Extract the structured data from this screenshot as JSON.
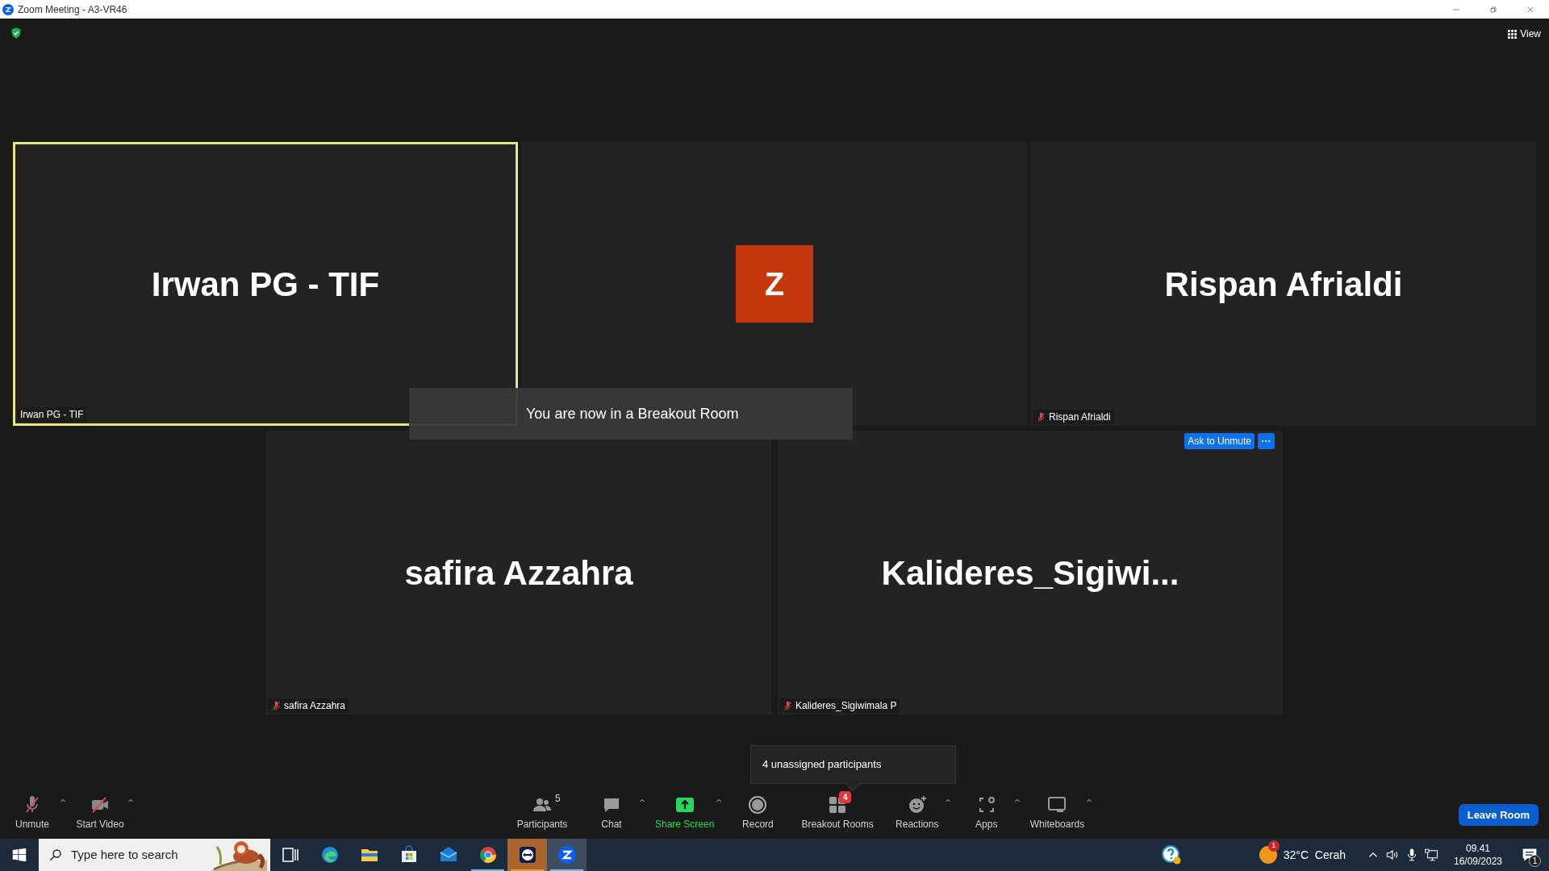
{
  "window": {
    "title": "Zoom Meeting - A3-VR46"
  },
  "top_bar": {
    "view_label": "View"
  },
  "tile_rows": [
    [
      {
        "kind": "name",
        "display": "Irwan PG - TIF",
        "label": "Irwan PG - TIF",
        "muted": false,
        "speaking": true
      },
      {
        "kind": "avatar",
        "display": "Z",
        "muted": false,
        "speaking": false
      },
      {
        "kind": "name",
        "display": "Rispan Afrialdi",
        "label": "Rispan Afrialdi",
        "muted": true,
        "speaking": false
      }
    ],
    [
      {
        "kind": "name",
        "display": "safira Azzahra",
        "label": "safira Azzahra",
        "muted": true,
        "speaking": false
      },
      {
        "kind": "name",
        "display": "Kalideres_Sigiwi...",
        "label": "Kalideres_Sigiwimala P",
        "muted": true,
        "speaking": false,
        "actions": {
          "ask_label": "Ask to Unmute",
          "more_label": "···"
        }
      }
    ]
  ],
  "toast": {
    "text": "You are now in a Breakout Room"
  },
  "tooltip": {
    "text": "4 unassigned participants"
  },
  "toolbar": {
    "left": [
      {
        "kind": "audio",
        "label": "Unmute",
        "off": true,
        "caret": true
      },
      {
        "kind": "video",
        "label": "Start Video",
        "off": true,
        "caret": true
      }
    ],
    "center": [
      {
        "kind": "participants",
        "label": "Participants",
        "count": "5",
        "caret": false
      },
      {
        "kind": "chat",
        "label": "Chat",
        "caret": true
      },
      {
        "kind": "share",
        "label": "Share Screen",
        "caret": true
      },
      {
        "kind": "record",
        "label": "Record",
        "caret": false
      },
      {
        "kind": "breakout",
        "label": "Breakout Rooms",
        "badge": "4",
        "caret": false
      },
      {
        "kind": "reactions",
        "label": "Reactions",
        "caret": true
      },
      {
        "kind": "apps",
        "label": "Apps",
        "caret": true
      },
      {
        "kind": "whiteboards",
        "label": "Whiteboards",
        "caret": true
      }
    ],
    "leave_label": "Leave Room"
  },
  "taskbar": {
    "search": {
      "placeholder": "Type here to search"
    },
    "apps": [
      {
        "kind": "taskview",
        "running": false,
        "selected": false,
        "flashing": false
      },
      {
        "kind": "edge",
        "running": false,
        "selected": false,
        "flashing": false
      },
      {
        "kind": "files",
        "running": false,
        "selected": false,
        "flashing": false
      },
      {
        "kind": "store",
        "running": false,
        "selected": false,
        "flashing": false
      },
      {
        "kind": "mail",
        "running": false,
        "selected": false,
        "flashing": false
      },
      {
        "kind": "chrome",
        "running": true,
        "selected": false,
        "flashing": false
      },
      {
        "kind": "remote",
        "running": true,
        "selected": false,
        "flashing": true
      },
      {
        "kind": "zoom",
        "running": true,
        "selected": true,
        "flashing": false
      }
    ],
    "weather": {
      "badge": "1",
      "temperature": "32°C",
      "condition": "Cerah"
    },
    "time": "09.41",
    "date": "16/09/2023",
    "notification_count": "1"
  }
}
